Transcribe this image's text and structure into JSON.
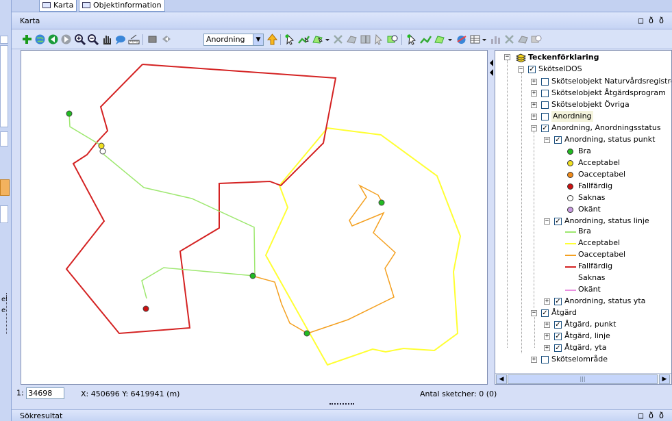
{
  "tabs": [
    {
      "label": "Karta"
    },
    {
      "label": "Objektinformation"
    }
  ],
  "karta_panel": {
    "title": "Karta",
    "window_buttons": {
      "minimize": "□",
      "restore": "ð",
      "close": "ð"
    }
  },
  "toolbar": {
    "layer_select": {
      "value": "Anordning",
      "arrow": "▼"
    },
    "tool_icons": [
      "add-icon",
      "globe-icon",
      "back-icon",
      "forward-icon",
      "zoom-in-icon",
      "zoom-out-icon",
      "pan-hand-icon",
      "identify-icon",
      "measure-icon",
      "select-box-icon",
      "previous-extent-icon",
      "layer-up-icon",
      "edit-point-icon",
      "edit-line-icon",
      "edit-polygon-icon",
      "tool-dropdown-icon",
      "delete-icon",
      "merge-icon",
      "split-icon",
      "move-icon",
      "zoom-feature-icon"
    ]
  },
  "map": {
    "features": {
      "red_polygon": "Fallfärdig",
      "yellow_polygon": "Acceptabel",
      "orange_line": "Oacceptabel",
      "green_line": "Bra",
      "point_colors": {
        "bra": "#22bb22",
        "acceptabel": "#f0e020",
        "oacceptabel": "#f08a1a",
        "fallfardig": "#cc1111",
        "saknas": "#ffffff",
        "okant": "#c89be0"
      },
      "line_colors": {
        "bra": "#9ee870",
        "acceptabel": "#ffff33",
        "oacceptabel": "#f4a020",
        "fallfardig": "#d42222",
        "okant": "#e98fe0"
      }
    }
  },
  "legend": {
    "root": "Teckenförklaring",
    "group": "SkötselDOS",
    "items": [
      {
        "label": "Skötselobjekt Naturvårdsregistret"
      },
      {
        "label": "Skötselobjekt Åtgärdsprogram"
      },
      {
        "label": "Skötselobjekt Övriga"
      },
      {
        "label": "Anordning"
      },
      {
        "label": "Anordning, Anordningsstatus"
      },
      {
        "label": "Anordning, status punkt"
      },
      {
        "label": "Bra"
      },
      {
        "label": "Acceptabel"
      },
      {
        "label": "Oacceptabel"
      },
      {
        "label": "Fallfärdig"
      },
      {
        "label": "Saknas"
      },
      {
        "label": "Okänt"
      },
      {
        "label": "Anordning, status linje"
      },
      {
        "label": "Bra"
      },
      {
        "label": "Acceptabel"
      },
      {
        "label": "Oacceptabel"
      },
      {
        "label": "Fallfärdig"
      },
      {
        "label": "Saknas"
      },
      {
        "label": "Okänt"
      },
      {
        "label": "Anordning, status yta"
      },
      {
        "label": "Åtgärd"
      },
      {
        "label": "Åtgärd, punkt"
      },
      {
        "label": "Åtgärd, linje"
      },
      {
        "label": "Åtgärd, yta"
      },
      {
        "label": "Skötselområde"
      }
    ],
    "scroll_left": "◀",
    "scroll_right": "▶",
    "thumb_grip": "|||"
  },
  "status": {
    "scale_prefix": "1:",
    "scale_value": "34698",
    "coords": "X: 450696  Y: 6419941 (m)",
    "sketch_count": "Antal sketcher: 0  (0)"
  },
  "bottom_panel": {
    "title": "Sökresultat",
    "window_buttons": {
      "minimize": "□",
      "restore": "ð",
      "close": "ð"
    }
  },
  "left_strip": {
    "texts": [
      "el",
      "e"
    ]
  }
}
